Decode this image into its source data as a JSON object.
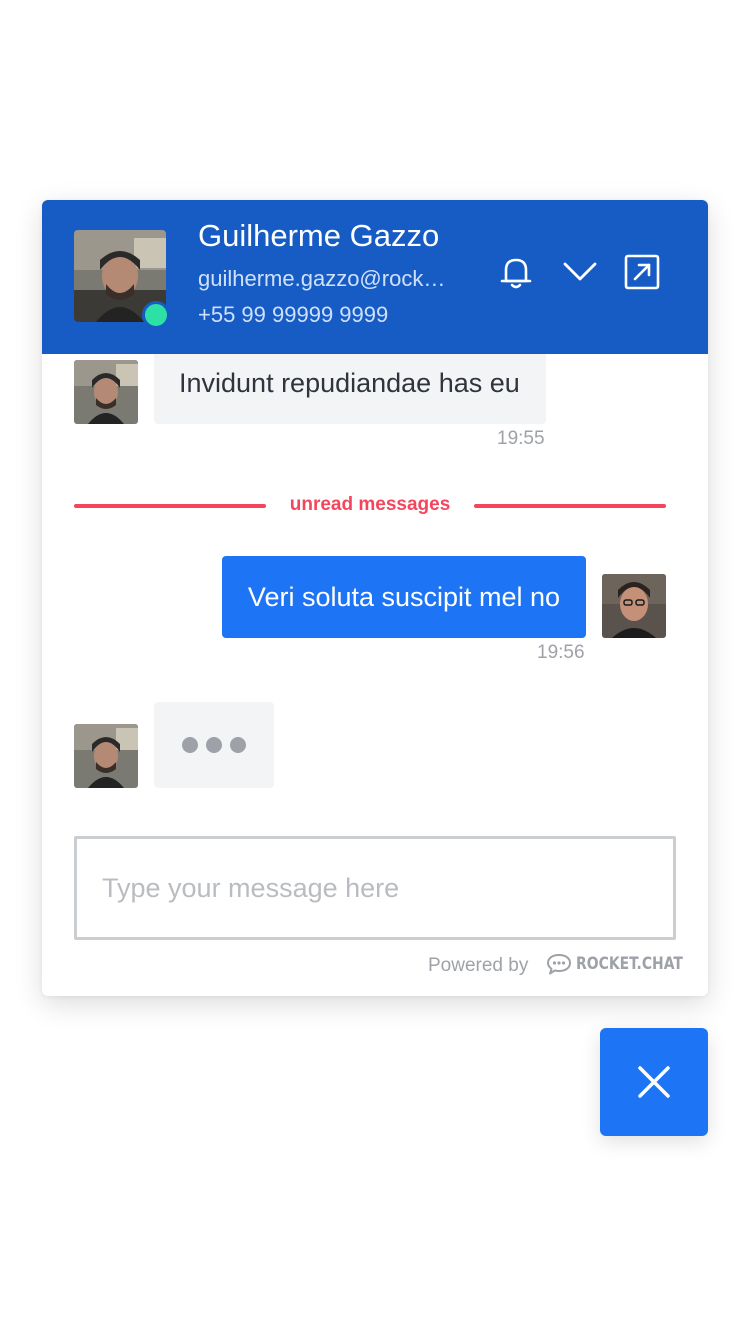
{
  "header": {
    "name": "Guilherme Gazzo",
    "email": "guilherme.gazzo@rocket.chat",
    "phone": "+55 99 99999 9999",
    "status": "online",
    "background_color": "#175cc4",
    "actions": [
      {
        "icon": "bell-icon"
      },
      {
        "icon": "chevron-down-icon"
      },
      {
        "icon": "popout-icon"
      }
    ]
  },
  "messages": [
    {
      "direction": "incoming",
      "text": "Invidunt repudiandae has eu",
      "time": "19:55"
    },
    {
      "direction": "outgoing",
      "text": "Veri soluta suscipit mel no",
      "time": "19:56"
    }
  ],
  "separator": {
    "label": "unread messages",
    "color": "#f5455c"
  },
  "typing_indicator": {
    "direction": "incoming",
    "icon": "typing-dots-icon"
  },
  "composer": {
    "placeholder": "Type your message here",
    "value": ""
  },
  "footer": {
    "powered_by": "Powered by",
    "brand": "ROCKET.CHAT"
  },
  "fab": {
    "icon": "close-icon",
    "color": "#1d74f5"
  }
}
